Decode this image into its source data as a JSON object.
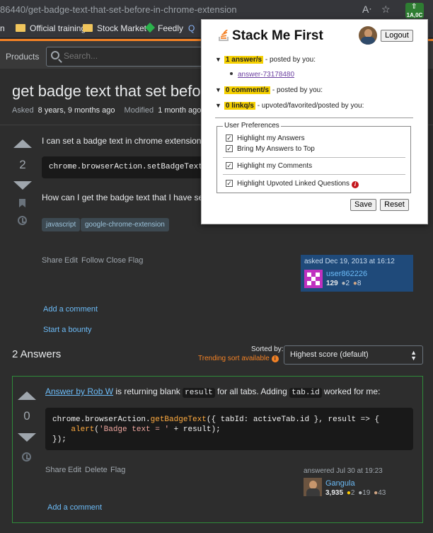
{
  "browser": {
    "url": "86440/get-badge-text-that-set-before-in-chrome-extension",
    "ext_badge": "1A,0C",
    "bookmarks": [
      {
        "label": "n",
        "kind": "text"
      },
      {
        "label": "Official training",
        "kind": "folder"
      },
      {
        "label": "Stock Market",
        "kind": "folder"
      },
      {
        "label": "Feedly",
        "kind": "feedly"
      }
    ]
  },
  "so": {
    "products": "Products",
    "search_placeholder": "Search..."
  },
  "question": {
    "title": "get badge text that set befo",
    "asked_label": "Asked",
    "asked_value": "8 years, 9 months ago",
    "modified_label": "Modified",
    "modified_value": "1 month ago",
    "votes": "2",
    "body1": "I can set a badge text in chrome extension",
    "code": "chrome.browserAction.setBadgeText({t",
    "body2": "How can I get the badge text that I have se",
    "tags": [
      "javascript",
      "google-chrome-extension"
    ],
    "menu": [
      "Share",
      "Edit",
      "Follow",
      "Close",
      "Flag"
    ],
    "asked_card": "asked Dec 19, 2013 at 16:12",
    "user": "user862226",
    "rep": "129",
    "silver": "2",
    "bronze": "8",
    "add_comment": "Add a comment",
    "bounty": "Start a bounty"
  },
  "answers": {
    "heading": "2 Answers",
    "sorted_by": "Sorted by:",
    "trending": "Trending sort available",
    "sort_value": "Highest score (default)",
    "votes": "0",
    "link_text": "Answer by Rob W",
    "text_a": " is returning blank ",
    "code_result": "result",
    "text_b": " for all tabs. Adding ",
    "code_tabid": "tab.id",
    "text_c": " worked for me:",
    "code_l1a": "chrome.browserAction.",
    "code_l1fn": "getBadgeText",
    "code_l1b": "({ tabId: activeTab.id }, result => {",
    "code_l2a": "    ",
    "code_l2fn": "alert",
    "code_l2str": "'Badge text = '",
    "code_l2b": " + result);",
    "code_l3": "});",
    "menu": [
      "Share",
      "Edit",
      "Delete",
      "Flag"
    ],
    "answered": "answered Jul 30 at 19:23",
    "user": "Gangula",
    "rep": "3,935",
    "gold": "2",
    "silver": "19",
    "bronze": "43",
    "add_comment": "Add a comment"
  },
  "popup": {
    "title": "Stack Me First",
    "logout": "Logout",
    "answers_badge": "1 answer/s",
    "answers_text": " - posted by you:",
    "answer_link": "answer-73178480",
    "comments_badge": "0 comment/s",
    "comments_text": " - posted by you:",
    "links_badge": "0 linkq/s",
    "links_text": " - upvoted/favorited/posted by you:",
    "prefs_legend": "User Preferences",
    "pref1": "Highlight my Answers",
    "pref2": "Bring My Answers to Top",
    "pref3": "Highlight my Comments",
    "pref4": "Highlight Upvoted Linked Questions",
    "save": "Save",
    "reset": "Reset"
  },
  "colors": {
    "accent_orange": "#f48225",
    "link_blue": "#6cbbf7",
    "answer_border": "#2f8a3a",
    "highlight_yellow": "#f5d000"
  }
}
